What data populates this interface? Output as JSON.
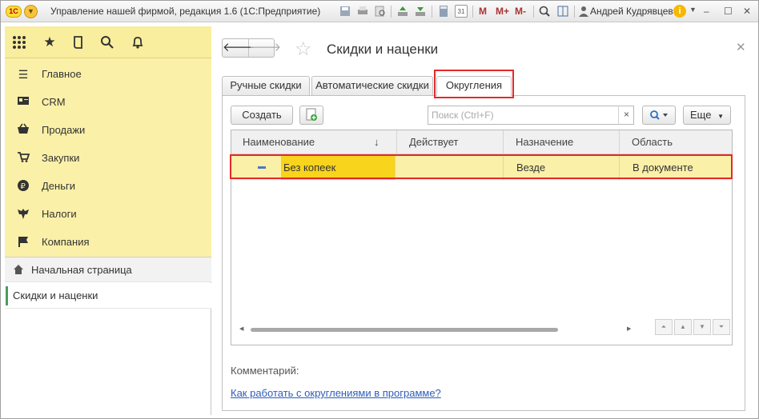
{
  "window": {
    "title": "Управление нашей фирмой, редакция 1.6  (1С:Предприятие)",
    "logo": "1С",
    "user": "Андрей Кудрявцев",
    "toolbar": {
      "m": "M",
      "m_plus": "M+",
      "m_minus": "M-",
      "calendar_day": "31"
    }
  },
  "sidebar": {
    "sections": [
      {
        "label": "Главное",
        "icon": "menu-lines-icon"
      },
      {
        "label": "CRM",
        "icon": "crm-card-icon"
      },
      {
        "label": "Продажи",
        "icon": "basket-icon"
      },
      {
        "label": "Закупки",
        "icon": "cart-icon"
      },
      {
        "label": "Деньги",
        "icon": "ruble-coin-icon"
      },
      {
        "label": "Налоги",
        "icon": "eagle-emblem-icon"
      },
      {
        "label": "Компания",
        "icon": "flag-icon"
      }
    ],
    "open_windows": {
      "home": "Начальная страница",
      "active": "Скидки и наценки"
    }
  },
  "form": {
    "title": "Скидки и наценки",
    "tabs": [
      {
        "label": "Ручные скидки",
        "active": false
      },
      {
        "label": "Автоматические скидки",
        "active": false
      },
      {
        "label": "Округления",
        "active": true
      }
    ],
    "create_button": "Создать",
    "search_placeholder": "Поиск (Ctrl+F)",
    "search_clear": "×",
    "more_button": "Еще",
    "table": {
      "columns": [
        "Наименование",
        "Действует",
        "Назначение",
        "Область"
      ],
      "rows": [
        {
          "name": "Без копеек",
          "active": "",
          "purpose": "Везде",
          "area": "В документе"
        }
      ]
    },
    "comment_label": "Комментарий:",
    "help_link": "Как работать с округлениями в программе?"
  },
  "colors": {
    "section_bg": "#fbf0a8",
    "selected_cell": "#f8d41c",
    "highlight_frame": "#e32a2a",
    "link": "#2f5dbb"
  }
}
